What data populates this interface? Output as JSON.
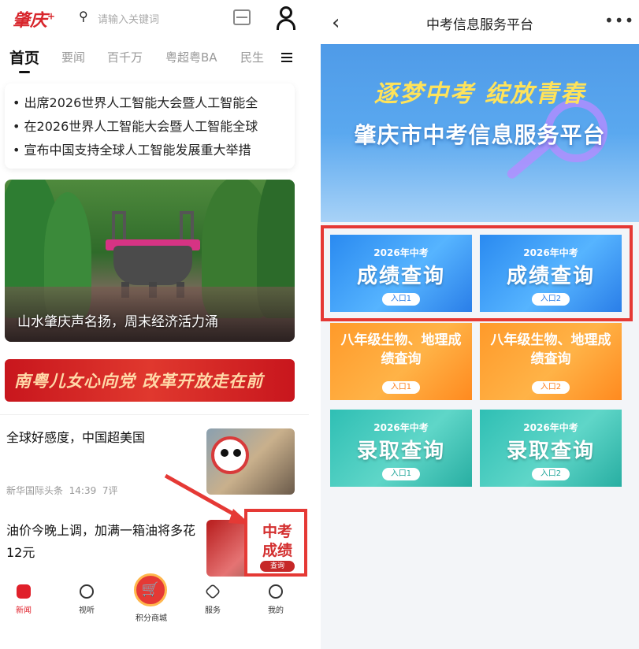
{
  "left": {
    "logo": "肇庆",
    "logo_mark": "+",
    "search_placeholder": "请输入关键词",
    "tabs": [
      "首页",
      "要闻",
      "百千万",
      "粤超粤BA",
      "民生"
    ],
    "headlines": [
      "• 出席2026世界人工智能大会暨人工智能全",
      "• 在2026世界人工智能大会暨人工智能全球",
      "• 宣布中国支持全球人工智能发展重大举措"
    ],
    "banner_caption": "山水肇庆声名扬，周末经济活力涌",
    "slogan": "南粤儿女心向党 改革开放走在前",
    "news": [
      {
        "title": "全球好感度，中国超美国",
        "source": "新华国际头条",
        "time": "14:39",
        "comments": "7评"
      },
      {
        "title": "油价今晚上调，加满一箱油将多花12元"
      }
    ],
    "badge": {
      "line1": "中考",
      "line2": "成绩",
      "line3": "查询"
    },
    "nav": [
      "新闻",
      "视听",
      "积分商城",
      "服务",
      "我的"
    ]
  },
  "right": {
    "title": "中考信息服务平台",
    "hero_line1": "逐梦中考 绽放青春",
    "hero_line2": "肇庆市中考信息服务平台",
    "tiles": [
      {
        "year": "2026年中考",
        "label": "成绩查询",
        "entry": "入口1"
      },
      {
        "year": "2026年中考",
        "label": "成绩查询",
        "entry": "入口2"
      },
      {
        "label": "八年级生物、地理成绩查询",
        "entry": "入口1"
      },
      {
        "label": "八年级生物、地理成绩查询",
        "entry": "入口2"
      },
      {
        "year": "2026年中考",
        "label": "录取查询",
        "entry": "入口1"
      },
      {
        "year": "2026年中考",
        "label": "录取查询",
        "entry": "入口2"
      }
    ]
  },
  "colors": {
    "brand_red": "#e0202a",
    "highlight": "#e53935",
    "tile_blue": "#2a8af0",
    "tile_orange": "#ff9a2a",
    "tile_green": "#2fbfb4"
  }
}
